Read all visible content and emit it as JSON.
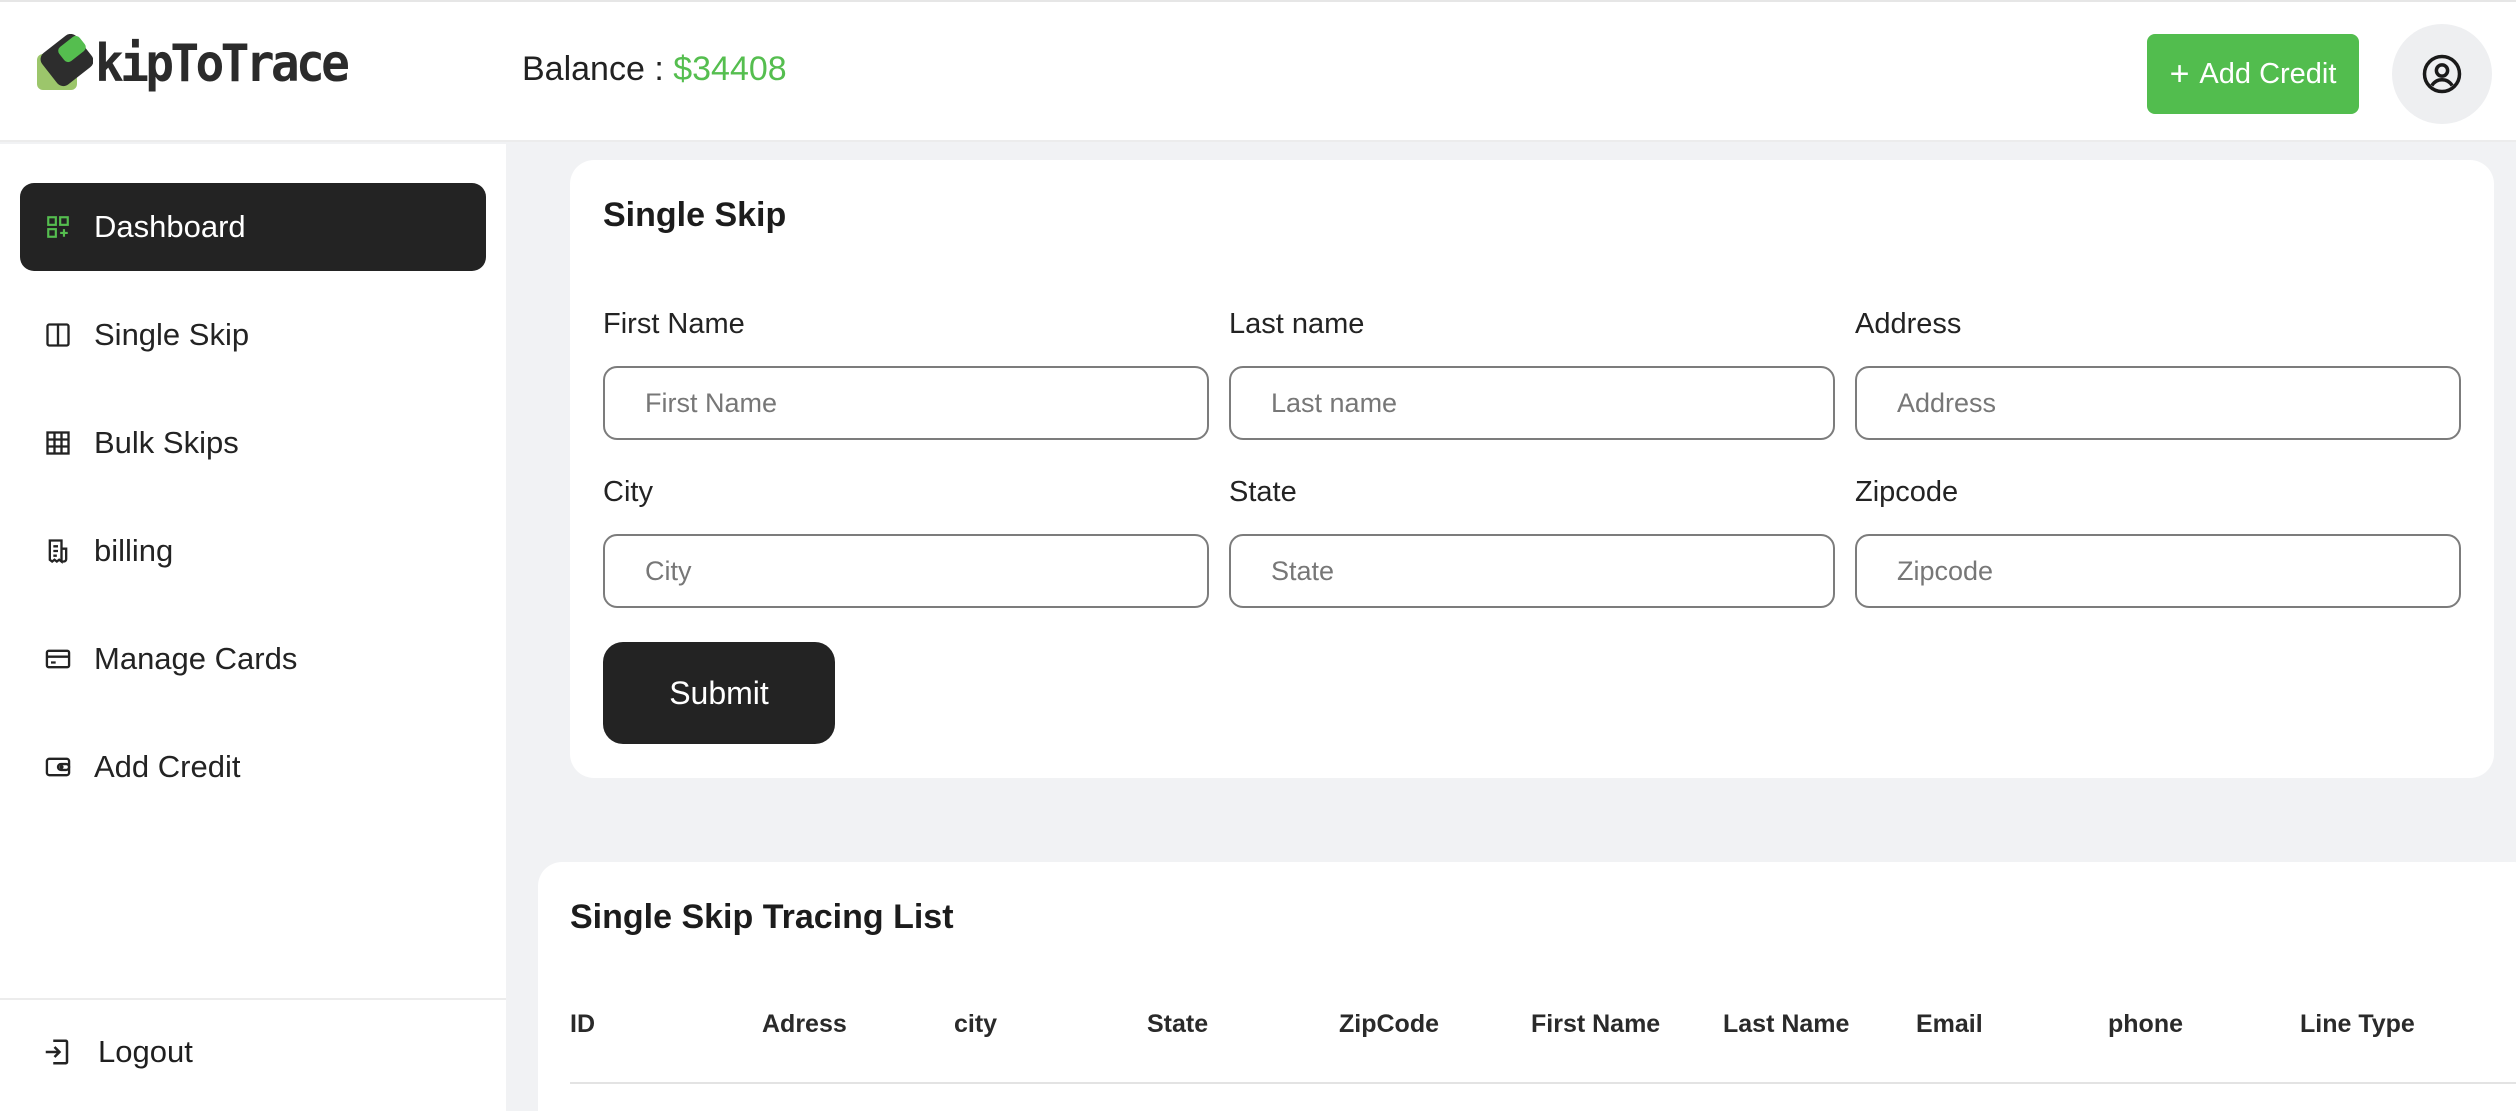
{
  "header": {
    "logo_text": "kipToTrace",
    "balance_label": "Balance : ",
    "balance_amount": "$34408",
    "add_credit_label": "Add Credit"
  },
  "sidebar": {
    "items": [
      {
        "label": "Dashboard",
        "icon": "dashboard-grid-icon",
        "active": true
      },
      {
        "label": "Single Skip",
        "icon": "columns-icon"
      },
      {
        "label": "Bulk Skips",
        "icon": "table-grid-icon"
      },
      {
        "label": "billing",
        "icon": "receipt-icon"
      },
      {
        "label": "Manage Cards",
        "icon": "credit-card-icon"
      },
      {
        "label": "Add Credit",
        "icon": "wallet-icon"
      }
    ],
    "logout_label": "Logout"
  },
  "single_skip": {
    "title": "Single Skip",
    "fields": [
      {
        "label": "First Name",
        "placeholder": "First Name",
        "value": ""
      },
      {
        "label": "Last name",
        "placeholder": "Last name",
        "value": ""
      },
      {
        "label": "Address",
        "placeholder": "Address",
        "value": ""
      },
      {
        "label": "City",
        "placeholder": "City",
        "value": ""
      },
      {
        "label": "State",
        "placeholder": "State",
        "value": ""
      },
      {
        "label": "Zipcode",
        "placeholder": "Zipcode",
        "value": ""
      }
    ],
    "submit_label": "Submit"
  },
  "list": {
    "title": "Single Skip Tracing List",
    "columns": [
      "ID",
      "Adress",
      "city",
      "State",
      "ZipCode",
      "First Name",
      "Last Name",
      "Email",
      "phone",
      "Line Type"
    ]
  },
  "colors": {
    "accent_green": "#52bd4e",
    "dark": "#232323"
  }
}
